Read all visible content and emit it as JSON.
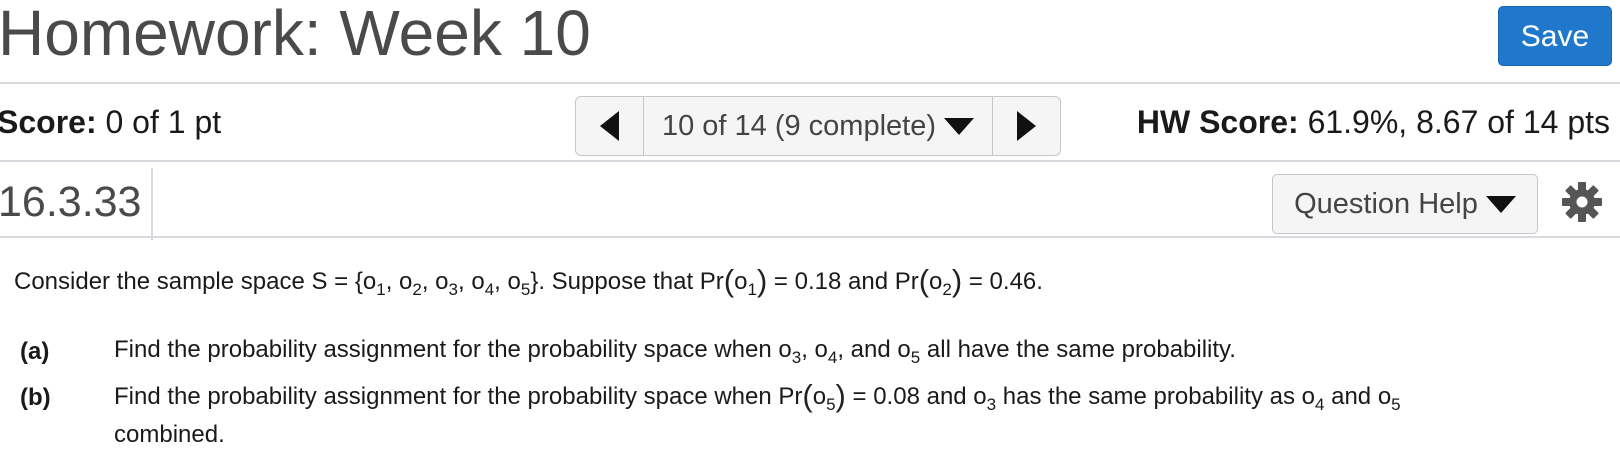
{
  "header": {
    "title": "Homework: Week 10",
    "save_label": "Save"
  },
  "score_row": {
    "score_label": "Score:",
    "score_value": "0 of 1 pt",
    "pager_text": "10 of 14 (9 complete)",
    "hw_score_label": "HW Score:",
    "hw_score_value": "61.9%, 8.67 of 14 pts"
  },
  "question": {
    "id": "16.3.33",
    "help_label": "Question Help",
    "intro": {
      "t1": "Consider the sample space S = {o",
      "s1": "1",
      "t2": ", o",
      "s2": "2",
      "t3": ", o",
      "s3": "3",
      "t4": ", o",
      "s4": "4",
      "t5": ", o",
      "s5": "5",
      "t6": "}. Suppose that Pr",
      "t7": "o",
      "s6": "1",
      "t8": " = 0.18 and Pr",
      "t9": "o",
      "s7": "2",
      "t10": " = 0.46."
    },
    "parts": [
      {
        "label": "(a)",
        "t1": "Find the probability assignment for the probability space when o",
        "s1": "3",
        "t2": ", o",
        "s2": "4",
        "t3": ", and o",
        "s3": "5",
        "t4": " all have the same probability."
      },
      {
        "label": "(b)",
        "t1": "Find the probability assignment for the probability space when Pr",
        "t2": "o",
        "s1": "5",
        "t3": " = 0.08 and o",
        "s2": "3",
        "t4": " has the same probability as o",
        "s3": "4",
        "t5": " and o",
        "s4": "5",
        "line2": "combined."
      }
    ]
  },
  "icons": {
    "prev": "triangle-left-icon",
    "next": "triangle-right-icon",
    "dropdown": "caret-down-icon",
    "settings": "gear-icon"
  },
  "colors": {
    "save_button": "#1f78cc",
    "divider": "#d7dbe0",
    "title_text": "#4a4a4a"
  }
}
